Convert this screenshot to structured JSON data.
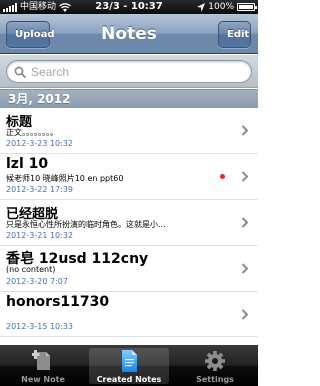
{
  "status_bar": {
    "carrier": "中国移动",
    "time": "23/3 - 10:37",
    "battery": "100%",
    "battery_level": 1.0
  },
  "nav": {
    "title": "Notes",
    "upload_label": "Upload",
    "edit_label": "Edit"
  },
  "search": {
    "placeholder": "Search"
  },
  "section_header": "3月, 2012",
  "notes": [
    {
      "title": "标题",
      "subtitle": "正文。。。。。。。。",
      "date": "2012-3-23 10:32",
      "unsynced": false
    },
    {
      "title": "lzl 10",
      "subtitle": "候老师10 晓峰照片10 en ppt60",
      "date": "2012-3-22 17:39",
      "unsynced": true
    },
    {
      "title": "已经超脱",
      "subtitle": "只是永恒心性所扮演的临时角色。这就是小...",
      "date": "2012-3-21 10:32",
      "unsynced": false
    },
    {
      "title": "香皂 12usd 112cny",
      "subtitle": "(no content)",
      "date": "2012-3-20 7:07",
      "unsynced": false
    },
    {
      "title": "honors11730",
      "subtitle": "",
      "date": "2012-3-15 10:33",
      "unsynced": false
    }
  ],
  "tabs": [
    {
      "label": "New Note",
      "icon": "new-note-icon",
      "active": false
    },
    {
      "label": "Created Notes",
      "icon": "document-icon",
      "active": true
    },
    {
      "label": "Settings",
      "icon": "gear-icon",
      "active": false
    }
  ],
  "colors": {
    "nav_bar": "#7b95b6",
    "date_text": "#4a6dbd",
    "unsynced_dot": "#e8262b",
    "section_header": "#97a7b8"
  }
}
